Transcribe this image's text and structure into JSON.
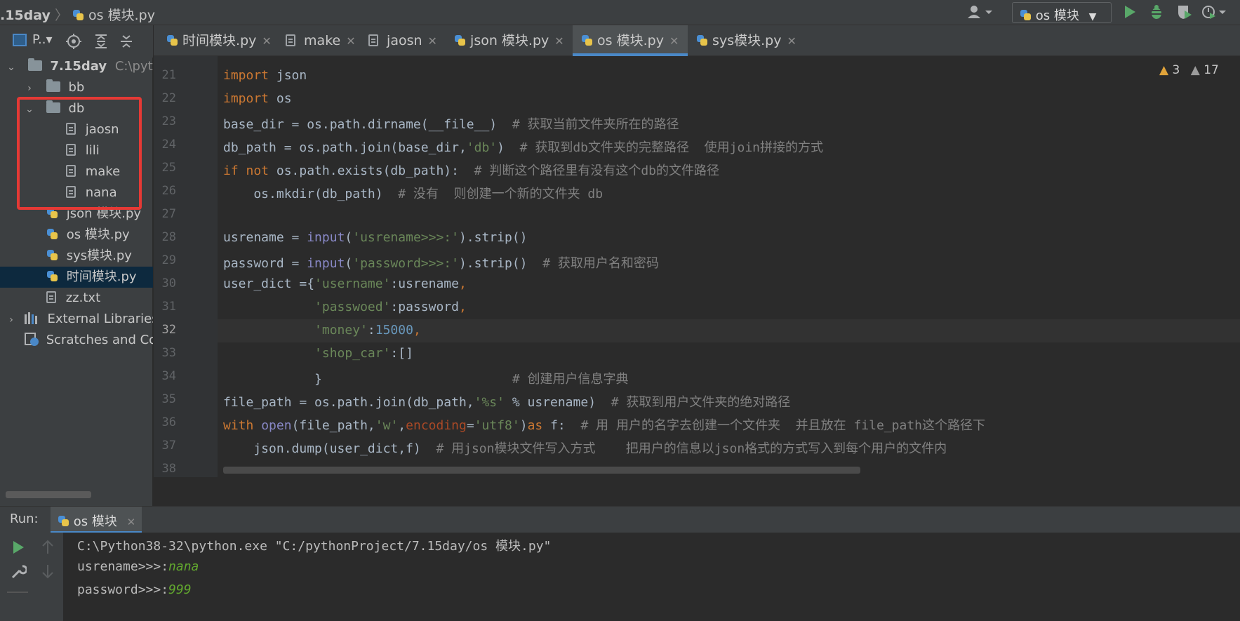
{
  "breadcrumb": {
    "project": ".15day",
    "separator": "〉",
    "file": "os 模块.py"
  },
  "run_config": {
    "label": "os 模块",
    "dropdown": "▼"
  },
  "toolbar_icons": [
    "user-icon",
    "run-icon",
    "debug-icon",
    "coverage-icon",
    "profile-icon"
  ],
  "project_toolbar": {
    "label": "P..▾"
  },
  "tree": [
    {
      "label": "7.15day",
      "extra": "C:\\pytho",
      "chev": "⌄",
      "indent": 0
    },
    {
      "label": "bb",
      "chev": "›",
      "indent": 1
    },
    {
      "label": "db",
      "chev": "⌄",
      "indent": 1
    },
    {
      "label": "jaosn",
      "indent": 2
    },
    {
      "label": "lili",
      "indent": 2
    },
    {
      "label": "make",
      "indent": 2
    },
    {
      "label": "nana",
      "indent": 2
    },
    {
      "label": "json 模块.py",
      "indent": 1
    },
    {
      "label": "os 模块.py",
      "indent": 1
    },
    {
      "label": "sys模块.py",
      "indent": 1
    },
    {
      "label": "时间模块.py",
      "indent": 1
    },
    {
      "label": "zz.txt",
      "indent": 1
    },
    {
      "label": "External Libraries",
      "chev": "›",
      "indent": 0
    },
    {
      "label": "Scratches and Cor",
      "indent": 0
    }
  ],
  "tabs": [
    {
      "label": "时间模块.py",
      "close": "✕"
    },
    {
      "label": "make",
      "close": "✕"
    },
    {
      "label": "jaosn",
      "close": "✕"
    },
    {
      "label": "json 模块.py",
      "close": "✕"
    },
    {
      "label": "os 模块.py",
      "close": "✕"
    },
    {
      "label": "sys模块.py",
      "close": "✕"
    }
  ],
  "inspections": {
    "warnings": "3",
    "weak_warnings": "17"
  },
  "line_numbers": [
    "21",
    "22",
    "23",
    "24",
    "25",
    "26",
    "27",
    "28",
    "29",
    "30",
    "31",
    "32",
    "33",
    "34",
    "35",
    "36",
    "37",
    "38"
  ],
  "current_line": "32",
  "run": {
    "label": "Run:",
    "tab": "os 模块",
    "close": "✕",
    "cmd": "C:\\Python38-32\\python.exe \"C:/pythonProject/7.15day/os 模块.py\"",
    "prompt1": "usrename>>>:",
    "input1": "nana",
    "prompt2": "password>>>:",
    "input2": "999"
  }
}
